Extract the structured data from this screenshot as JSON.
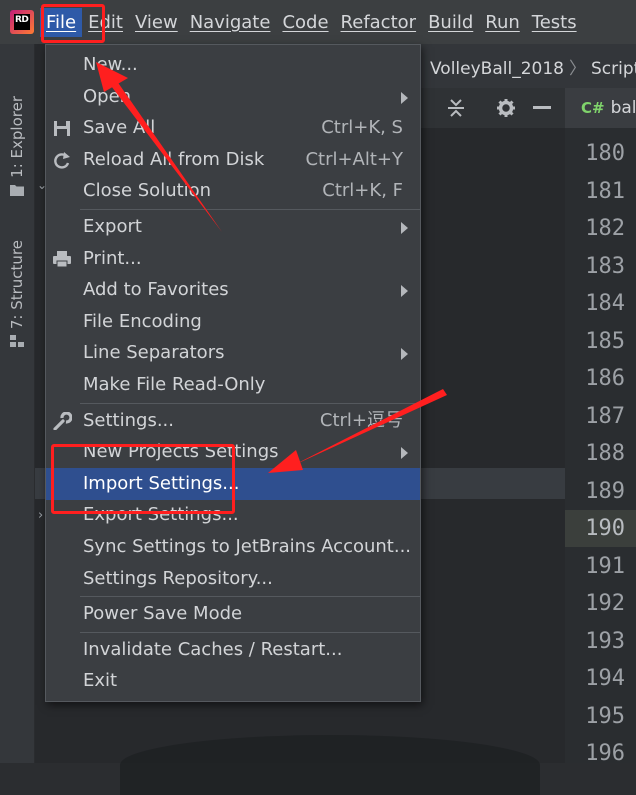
{
  "app": {
    "logo_text": "RD"
  },
  "menubar": {
    "items": [
      {
        "label": "File",
        "active": true
      },
      {
        "label": "Edit"
      },
      {
        "label": "View"
      },
      {
        "label": "Navigate"
      },
      {
        "label": "Code"
      },
      {
        "label": "Refactor"
      },
      {
        "label": "Build"
      },
      {
        "label": "Run"
      },
      {
        "label": "Tests"
      }
    ]
  },
  "left_strip": {
    "tabs": [
      {
        "label": "1: Explorer",
        "icon": "folder-icon"
      },
      {
        "label": "7: Structure",
        "icon": "structure-icon"
      }
    ]
  },
  "breadcrumb": {
    "project": "VolleyBall_2018",
    "folder": "Script"
  },
  "toolbar": {
    "icons": [
      "collapse-icon",
      "gear-icon",
      "minimize-icon"
    ]
  },
  "editor_tab": {
    "lang_badge": "C#",
    "filename": "bal"
  },
  "gutter": {
    "line_numbers": [
      "180",
      "181",
      "182",
      "183",
      "184",
      "185",
      "186",
      "187",
      "188",
      "189",
      "190",
      "191",
      "192",
      "193",
      "194",
      "195",
      "196"
    ],
    "current_line": "190"
  },
  "file_menu": {
    "groups": [
      [
        {
          "label": "New...",
          "submenu": false
        },
        {
          "label": "Open",
          "submenu": true
        },
        {
          "label": "Save All",
          "shortcut": "Ctrl+K, S",
          "icon": "save-icon"
        },
        {
          "label": "Reload All from Disk",
          "shortcut": "Ctrl+Alt+Y",
          "icon": "reload-icon"
        },
        {
          "label": "Close Solution",
          "shortcut": "Ctrl+K, F"
        }
      ],
      [
        {
          "label": "Export",
          "submenu": true
        },
        {
          "label": "Print...",
          "icon": "printer-icon"
        },
        {
          "label": "Add to Favorites",
          "submenu": true
        },
        {
          "label": "File Encoding"
        },
        {
          "label": "Line Separators",
          "submenu": true
        },
        {
          "label": "Make File Read-Only"
        }
      ],
      [
        {
          "label": "Settings...",
          "shortcut": "Ctrl+逗号",
          "icon": "wrench-icon"
        },
        {
          "label": "New Projects Settings",
          "submenu": true
        },
        {
          "label": "Import Settings...",
          "highlighted": true
        },
        {
          "label": "Export Settings..."
        },
        {
          "label": "Sync Settings to JetBrains Account..."
        },
        {
          "label": "Settings Repository..."
        }
      ],
      [
        {
          "label": "Power Save Mode"
        }
      ],
      [
        {
          "label": "Invalidate Caches / Restart..."
        },
        {
          "label": "Exit"
        }
      ]
    ]
  },
  "colors": {
    "menubar_bg": "#3c3f41",
    "menu_bg": "#3b3e42",
    "highlight": "#2f4f8f",
    "active_top_menu": "#2e5aa8",
    "annotation_red": "#ff1f1f"
  }
}
